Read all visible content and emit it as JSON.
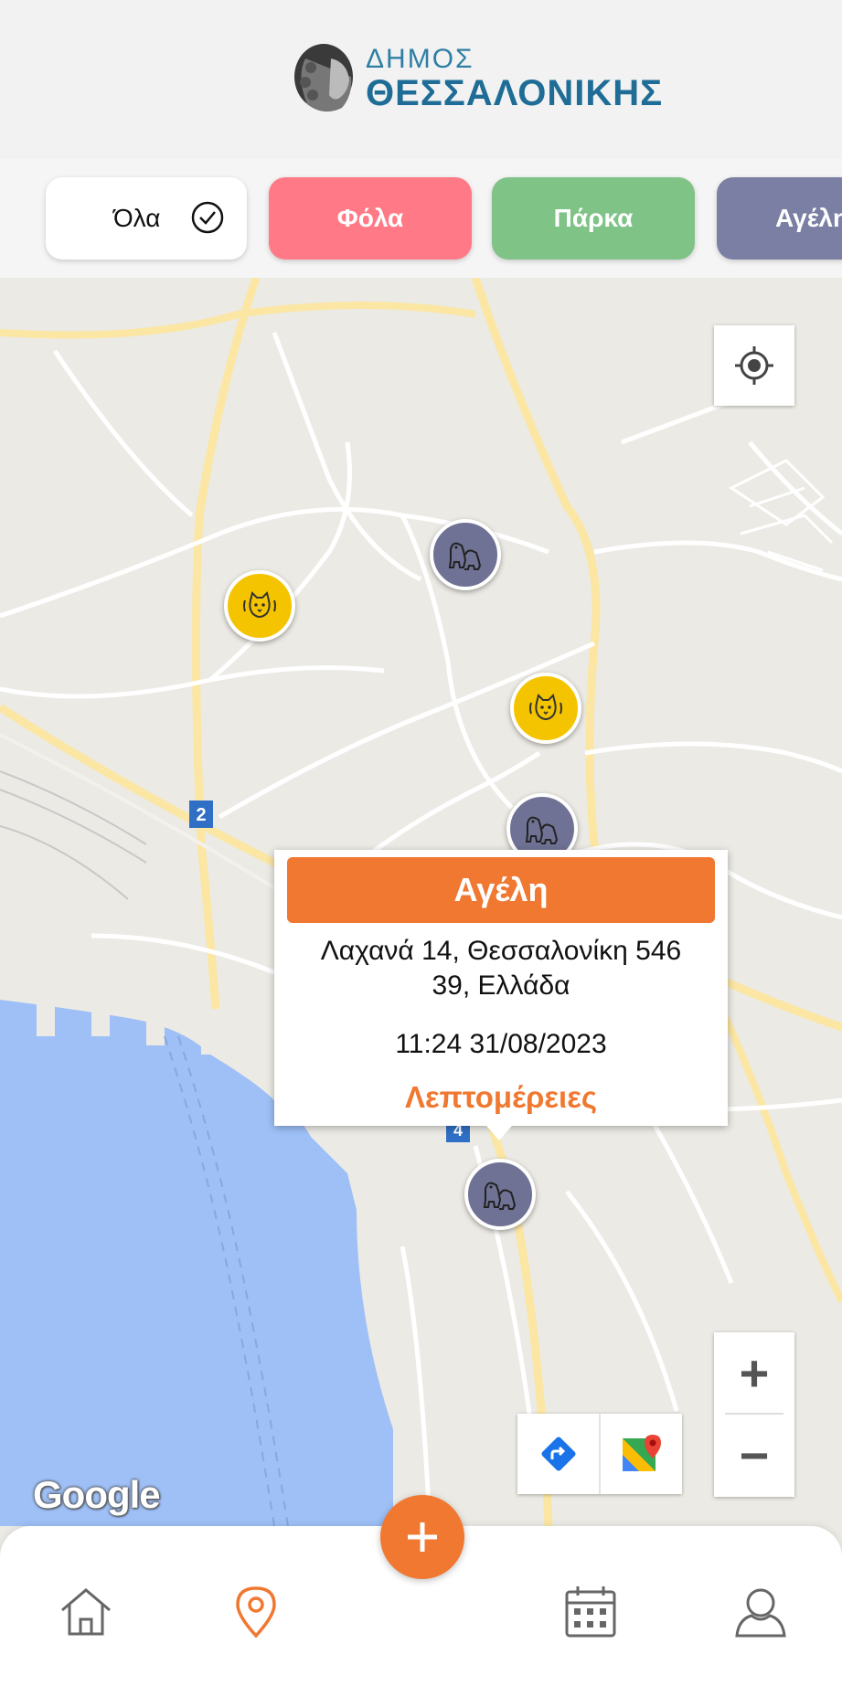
{
  "header": {
    "logo_line1": "ΔΗΜΟΣ",
    "logo_line2": "ΘΕΣΣΑΛΟΝΙΚΗΣ"
  },
  "filters": [
    {
      "label": "Όλα",
      "selected": true
    },
    {
      "label": "Φόλα",
      "color": "#ff7a86"
    },
    {
      "label": "Πάρκα",
      "color": "#7fc387"
    },
    {
      "label": "Αγέλη",
      "color": "#7a7fa3"
    }
  ],
  "map": {
    "road_badge_1": "2",
    "road_badge_2": "4",
    "attribution": "Google",
    "locate_icon": "crosshair-icon",
    "zoom_in_label": "+",
    "zoom_out_label": "−",
    "directions_icon": "directions-icon",
    "google_maps_icon": "google-maps-icon"
  },
  "markers": [
    {
      "type": "cat",
      "icon": "cat-icon",
      "color": "#f5c400"
    },
    {
      "type": "dogs",
      "icon": "dog-pack-icon",
      "color": "#6f7294"
    },
    {
      "type": "cat",
      "icon": "cat-icon",
      "color": "#f5c400"
    },
    {
      "type": "dogs",
      "icon": "dog-pack-icon",
      "color": "#6f7294"
    },
    {
      "type": "dogs",
      "icon": "dog-pack-icon",
      "color": "#6f7294"
    }
  ],
  "popup": {
    "title": "Αγέλη",
    "address_line1": "Λαχανά 14, Θεσσαλονίκη 546",
    "address_line2": "39, Ελλάδα",
    "time": "11:24 31/08/2023",
    "details_link": "Λεπτομέρειες"
  },
  "nav": {
    "home_icon": "home-icon",
    "map_icon": "map-pin-icon",
    "add_icon": "plus-icon",
    "calendar_icon": "calendar-icon",
    "profile_icon": "user-icon",
    "add_label": "+"
  },
  "colors": {
    "accent": "#f07830",
    "header_blue": "#1f6d96"
  }
}
